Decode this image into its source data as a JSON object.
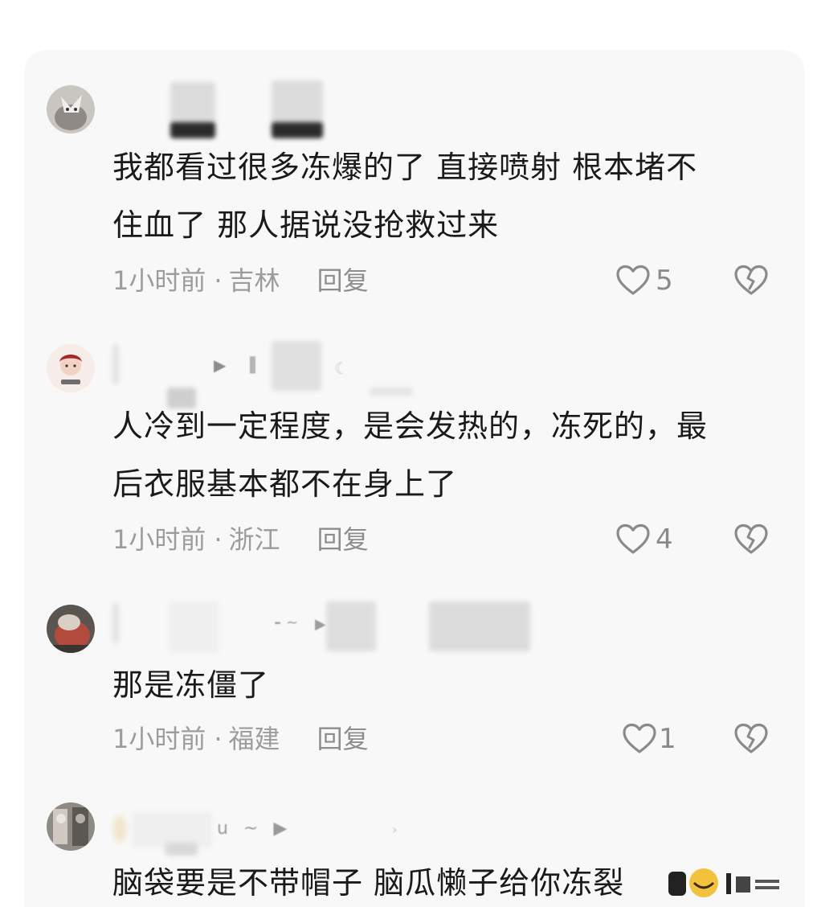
{
  "comments": [
    {
      "text_line1": "我都看过很多冻爆的了  直接喷射  根本堵不",
      "text_line2": "住血了  那人据说没抢救过来",
      "time": "1小时前",
      "location": "吉林",
      "reply_label": "回复",
      "likes": "5"
    },
    {
      "text_line1": "人冷到一定程度，是会发热的，冻死的，最",
      "text_line2": "后衣服基本都不在身上了",
      "time": "1小时前",
      "location": "浙江",
      "reply_label": "回复",
      "likes": "4"
    },
    {
      "text_line1": "那是冻僵了",
      "time": "1小时前",
      "location": "福建",
      "reply_label": "回复",
      "likes": "1"
    },
    {
      "text_line1": "脑袋要是不带帽子  脑瓜懒子给你冻裂",
      "username_fragment": "u ~ ▶"
    }
  ],
  "icons": {
    "like": "heart-outline-icon",
    "dislike": "broken-heart-icon"
  },
  "colors": {
    "text": "#1a1a1a",
    "meta": "#9c9c9c",
    "icon": "#8a8a8a",
    "background": "#f8f8f8"
  }
}
